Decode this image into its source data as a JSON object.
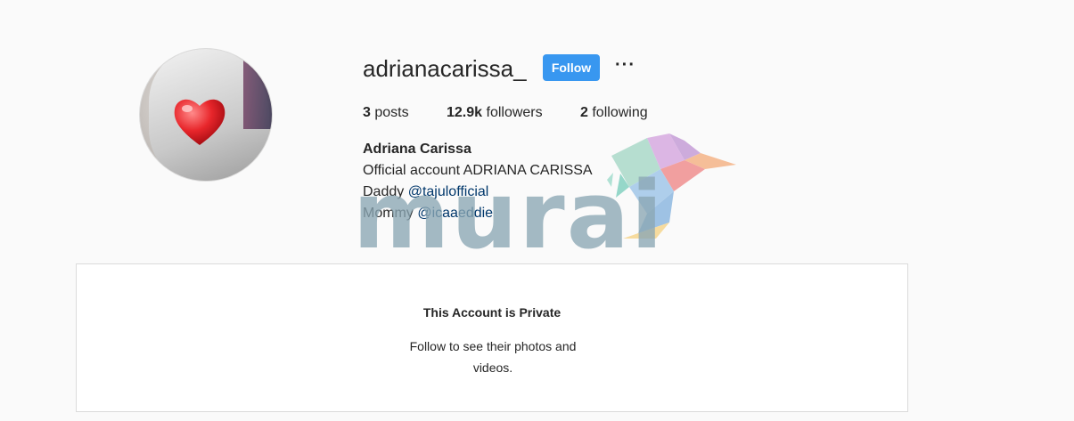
{
  "profile": {
    "username": "adrianacarissa_",
    "follow_label": "Follow",
    "more_label": "···",
    "stats": {
      "posts_count": "3",
      "posts_label": "posts",
      "followers_count": "12.9k",
      "followers_label": "followers",
      "following_count": "2",
      "following_label": "following"
    },
    "bio": {
      "name": "Adriana Carissa",
      "line1": "Official account ADRIANA CARISSA",
      "line2_prefix": "Daddy ",
      "line2_link": "@tajulofficial",
      "line3_prefix": "Mommy ",
      "line3_link": "@icaaeddie"
    }
  },
  "private_notice": {
    "title": "This Account is Private",
    "subtitle_line1": "Follow to see their photos and",
    "subtitle_line2": "videos."
  },
  "watermark": {
    "text": "murai"
  },
  "colors": {
    "follow_button": "#3897f0",
    "link": "#00376b",
    "background": "#fafafa"
  }
}
